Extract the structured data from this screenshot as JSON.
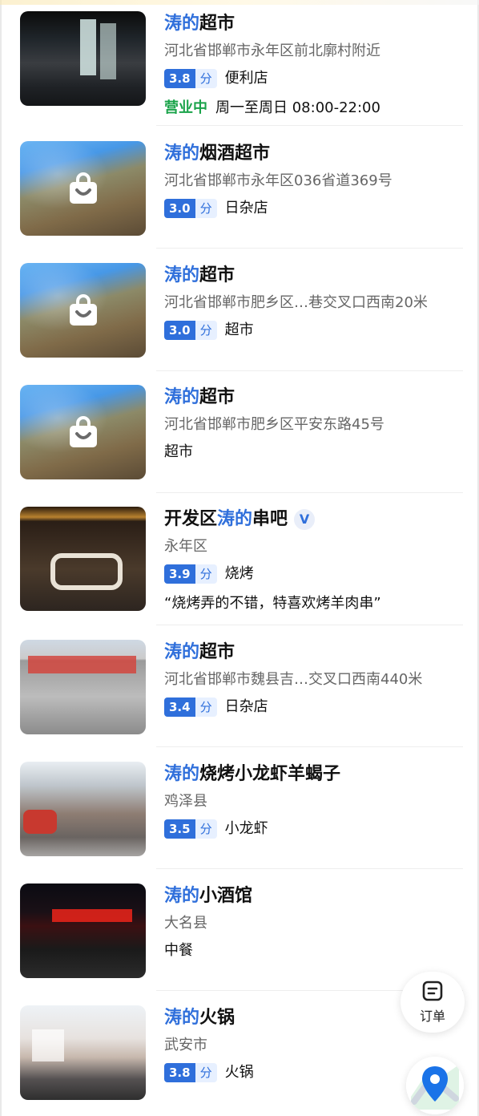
{
  "items": [
    {
      "title_hl": "涛的",
      "title_rest": "超市",
      "address": "河北省邯郸市永年区前北廓村附近",
      "rating": "3.8",
      "unit": "分",
      "category": "便利店",
      "status": "营业中",
      "hours": "周一至周日 08:00-22:00"
    },
    {
      "title_hl": "涛的",
      "title_rest": "烟酒超市",
      "address": "河北省邯郸市永年区036省道369号",
      "rating": "3.0",
      "unit": "分",
      "category": "日杂店"
    },
    {
      "title_hl": "涛的",
      "title_rest": "超市",
      "address": "河北省邯郸市肥乡区…巷交叉口西南20米",
      "rating": "3.0",
      "unit": "分",
      "category": "超市"
    },
    {
      "title_hl": "涛的",
      "title_rest": "超市",
      "address": "河北省邯郸市肥乡区平安东路45号",
      "category": "超市"
    },
    {
      "title_pre": "开发区",
      "title_hl": "涛的",
      "title_rest": "串吧",
      "badge": "V",
      "address": "永年区",
      "rating": "3.9",
      "unit": "分",
      "category": "烧烤",
      "quote": "“烧烤弄的不错，特喜欢烤羊肉串”"
    },
    {
      "title_hl": "涛的",
      "title_rest": "超市",
      "address": "河北省邯郸市魏县吉…交叉口西南440米",
      "rating": "3.4",
      "unit": "分",
      "category": "日杂店"
    },
    {
      "title_hl": "涛的",
      "title_rest": "烧烤小龙虾羊蝎子",
      "address": "鸡泽县",
      "rating": "3.5",
      "unit": "分",
      "category": "小龙虾"
    },
    {
      "title_hl": "涛的",
      "title_rest": "小酒馆",
      "address": "大名县",
      "category": "中餐"
    },
    {
      "title_hl": "涛的",
      "title_rest": "火锅",
      "address": "武安市",
      "rating": "3.8",
      "unit": "分",
      "category": "火锅"
    }
  ],
  "fab": {
    "order_label": "订单",
    "order_icon": "order-list-icon",
    "map_icon": "map-pin-icon"
  },
  "colors": {
    "accent": "#2f6fdb",
    "open": "#1aa34a"
  }
}
